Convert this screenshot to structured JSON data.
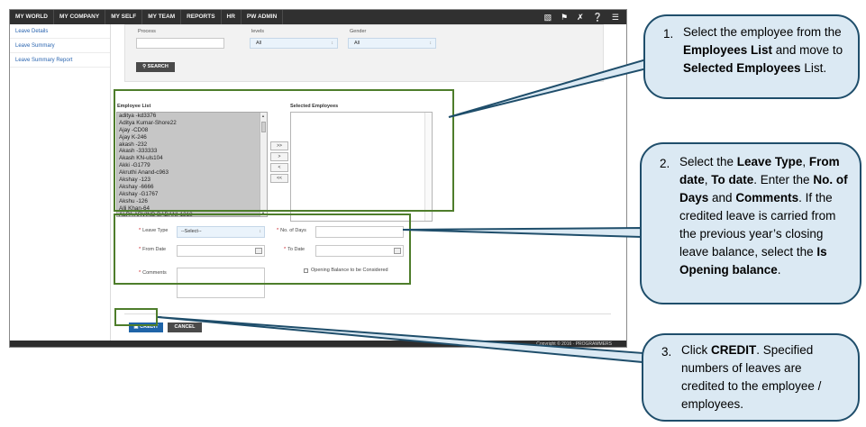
{
  "nav": {
    "items": [
      "MY WORLD",
      "MY COMPANY",
      "MY SELF",
      "MY TEAM",
      "REPORTS",
      "HR",
      "PW ADMIN"
    ],
    "icons": [
      "book-icon",
      "flag-icon",
      "tools-icon",
      "help-icon",
      "menu-icon"
    ]
  },
  "sidebar": {
    "items": [
      "Leave Details",
      "Leave Summary",
      "Leave Summary Report"
    ]
  },
  "filters": {
    "process_label": "Process",
    "levels_label": "levels",
    "levels_value": "All",
    "gender_label": "Gender",
    "gender_value": "All",
    "search_label": "SEARCH"
  },
  "lists": {
    "employee_list_label": "Employee List",
    "selected_employees_label": "Selected Employees",
    "employees": [
      "aditya -kd3376",
      "Aditya Kumar-Shore22",
      "Ajay -CD08",
      "Ajay K-246",
      "akash -232",
      "Akash -333333",
      "Akash KN-uls104",
      "Akki -G1779",
      "Akruthi Anand-c963",
      "Akshay -123",
      "Akshay -6666",
      "Akshay -G1767",
      "Akshu -126",
      "Alli Khan-64",
      "ALPA ARVIND BADANI-1218"
    ],
    "move_buttons": [
      ">>",
      ">",
      "<",
      "<<"
    ]
  },
  "form": {
    "leave_type_label": "Leave Type",
    "leave_type_value": "--Select--",
    "no_of_days_label": "No. of Days",
    "from_date_label": "From Date",
    "to_date_label": "To Date",
    "comments_label": "Comments",
    "opening_balance_label": "Opening Balance to be Considered"
  },
  "buttons": {
    "credit": "CREDIT",
    "cancel": "CANCEL"
  },
  "footer": {
    "brand": "Copyright © 2016 · PROGRAMMERS"
  },
  "callouts": {
    "c1": {
      "num": "1.",
      "text_parts": [
        "Select the employee from the ",
        "Employees List",
        " and move to ",
        "Selected Employees",
        " List."
      ]
    },
    "c2": {
      "num": "2.",
      "text_parts": [
        "Select the ",
        "Leave Type",
        ", ",
        "From date",
        ", ",
        "To date",
        ". Enter the ",
        "No. of Days",
        " and ",
        "Comments",
        ". If the credited leave is carried from the previous year’s closing leave balance, select the ",
        "Is Opening balance",
        "."
      ]
    },
    "c3": {
      "num": "3.",
      "text_parts": [
        "Click ",
        "CREDIT",
        ". Specified numbers of leaves are credited to the employee / employees."
      ]
    }
  },
  "colors": {
    "highlight": "#4e7d2b",
    "callout_fill": "#dbe9f3",
    "callout_border": "#1f4e6b",
    "credit_button": "#1f64a8",
    "nav_bg": "#303030"
  }
}
